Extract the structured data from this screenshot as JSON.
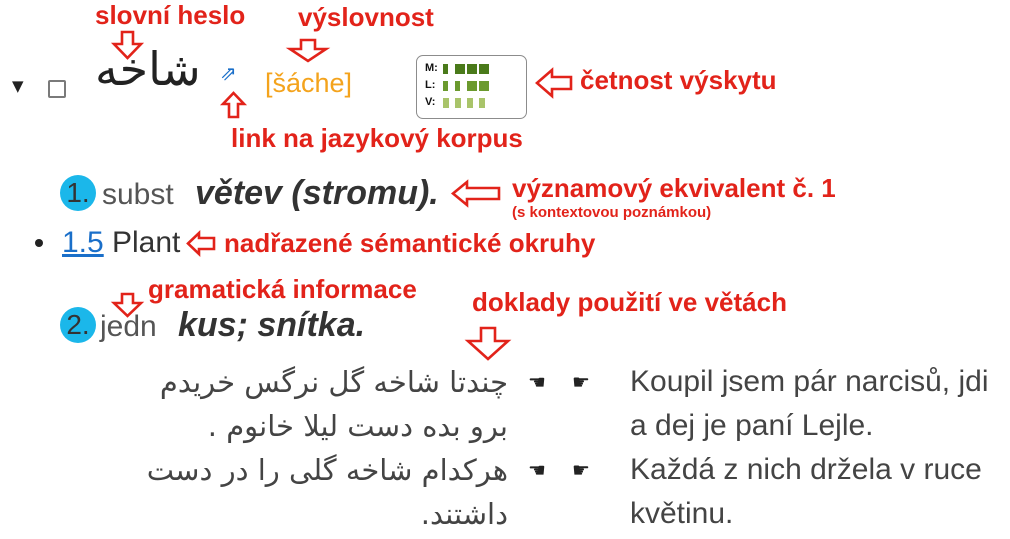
{
  "annotations": {
    "headword": "slovní heslo",
    "pronunciation": "výslovnost",
    "frequency": "četnost výskytu",
    "corpus_link": "link na jazykový korpus",
    "equivalent": "významový ekvivalent č. 1",
    "equivalent_note": "(s kontextovou poznámkou)",
    "domains": "nadřazené sémantické okruhy",
    "grammar": "gramatická informace",
    "examples": "doklady použití ve větách"
  },
  "icons": {
    "toggle": {
      "name": "triangle-down-icon",
      "glyph": "▼"
    },
    "corpus_link": {
      "name": "external-link-icon",
      "glyph": "⇗"
    },
    "example_left": {
      "name": "hand-pointing-left-icon",
      "glyph": "☚"
    },
    "example_right": {
      "name": "hand-pointing-right-icon",
      "glyph": "☛"
    }
  },
  "entry": {
    "headword": "شاخه",
    "pronunciation": "[šáche]",
    "frequency": {
      "rows": [
        {
          "label": "M:",
          "color": "#4a7a1a",
          "fills": [
            0.5,
            1,
            1,
            1
          ]
        },
        {
          "label": "L:",
          "color": "#6b9a2e",
          "fills": [
            0.5,
            0.5,
            1,
            1
          ]
        },
        {
          "label": "V:",
          "color": "#a9c46a",
          "fills": [
            0.6,
            0.6,
            0.6,
            0.6
          ]
        }
      ]
    },
    "senses": [
      {
        "number": "1.",
        "grammar": "subst",
        "equivalent": "větev (stromu).",
        "domains": [
          {
            "code": "1.5",
            "name": "Plant"
          }
        ]
      },
      {
        "number": "2.",
        "grammar": "jedn",
        "equivalent": "kus; snítka.",
        "examples": [
          {
            "source_lines": [
              "چندتا شاخه گل نرگس خریدم",
              "برو بده دست لیلا خانوم ."
            ],
            "target_lines": [
              "Koupil jsem pár narcisů, jdi",
              "a dej je paní Lejle."
            ]
          },
          {
            "source_lines": [
              "هرکدام شاخه گلی را در دست",
              "داشتند."
            ],
            "target_lines": [
              "Každá z nich držela v ruce",
              "květinu."
            ]
          }
        ]
      }
    ]
  },
  "colors": {
    "accent": "#1bb7ea",
    "link": "#1a6fc9",
    "pronunciation": "#f4a31c",
    "annotation": "#e2231a",
    "text": "#333333",
    "muted": "#555555"
  }
}
